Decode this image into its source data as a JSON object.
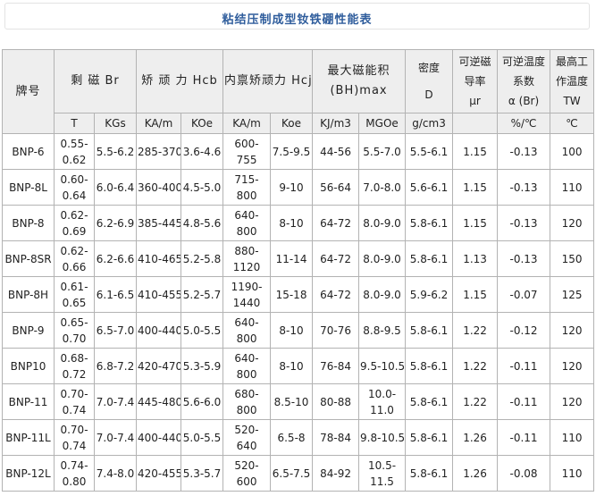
{
  "title": "粘结压制成型钕铁硼性能表",
  "table": {
    "header_row1": [
      {
        "key": "brand",
        "label": "牌号"
      },
      {
        "key": "br",
        "label": "剩 磁   Br"
      },
      {
        "key": "hcb",
        "label": "矫 顽 力   Hcb"
      },
      {
        "key": "hcj",
        "label": "内禀矫顽力 Hcj"
      },
      {
        "key": "bhmax",
        "label": "最大磁能积(BH)max"
      },
      {
        "key": "density",
        "label": "密度"
      },
      {
        "key": "mu",
        "label": "可逆磁导率"
      },
      {
        "key": "alpha",
        "label": "可逆温度系数"
      },
      {
        "key": "tw",
        "label": "最高工作温度"
      }
    ],
    "header_d": "D",
    "header_mu": "μr",
    "header_alpha": "α (Br)",
    "header_tw": "TW",
    "units": [
      "T",
      "KGs",
      "KA/m",
      "KOe",
      "KA/m",
      "Koe",
      "KJ/m3",
      "MGOe",
      "g/cm3",
      "",
      "%/℃",
      "℃"
    ],
    "rows": [
      [
        "BNP-6",
        "0.55-0.62",
        "5.5-6.2",
        "285-370",
        "3.6-4.6",
        "600-755",
        "7.5-9.5",
        "44-56",
        "5.5-7.0",
        "5.5-6.1",
        "1.15",
        "-0.13",
        "100"
      ],
      [
        "BNP-8L",
        "0.60-0.64",
        "6.0-6.4",
        "360-400",
        "4.5-5.0",
        "715-800",
        "9-10",
        "56-64",
        "7.0-8.0",
        "5.6-6.1",
        "1.15",
        "-0.13",
        "110"
      ],
      [
        "BNP-8",
        "0.62-0.69",
        "6.2-6.9",
        "385-445",
        "4.8-5.6",
        "640-800",
        "8-10",
        "64-72",
        "8.0-9.0",
        "5.8-6.1",
        "1.15",
        "-0.13",
        "120"
      ],
      [
        "BNP-8SR",
        "0.62-0.66",
        "6.2-6.6",
        "410-465",
        "5.2-5.8",
        "880-1120",
        "11-14",
        "64-72",
        "8.0-9.0",
        "5.8-6.1",
        "1.13",
        "-0.13",
        "150"
      ],
      [
        "BNP-8H",
        "0.61-0.65",
        "6.1-6.5",
        "410-455",
        "5.2-5.7",
        "1190-1440",
        "15-18",
        "64-72",
        "8.0-9.0",
        "5.9-6.2",
        "1.15",
        "-0.07",
        "125"
      ],
      [
        "BNP-9",
        "0.65-0.70",
        "6.5-7.0",
        "400-440",
        "5.0-5.5",
        "640-800",
        "8-10",
        "70-76",
        "8.8-9.5",
        "5.8-6.1",
        "1.22",
        "-0.12",
        "120"
      ],
      [
        "BNP10",
        "0.68-0.72",
        "6.8-7.2",
        "420-470",
        "5.3-5.9",
        "640-800",
        "8-10",
        "76-84",
        "9.5-10.5",
        "5.8-6.1",
        "1.22",
        "-0.11",
        "120"
      ],
      [
        "BNP-11",
        "0.70-0.74",
        "7.0-7.4",
        "445-480",
        "5.6-6.0",
        "680-800",
        "8.5-10",
        "80-88",
        "10.0-11.0",
        "5.8-6.1",
        "1.22",
        "-0.11",
        "120"
      ],
      [
        "BNP-11L",
        "0.70-0.74",
        "7.0-7.4",
        "400-440",
        "5.0-5.5",
        "520-640",
        "6.5-8",
        "78-84",
        "9.8-10.5",
        "5.8-6.1",
        "1.26",
        "-0.11",
        "110"
      ],
      [
        "BNP-12L",
        "0.74-0.80",
        "7.4-8.0",
        "420-455",
        "5.3-5.7",
        "520-600",
        "6.5-7.5",
        "84-92",
        "10.5-11.5",
        "5.8-6.1",
        "1.26",
        "-0.08",
        "110"
      ]
    ]
  },
  "colors": {
    "title": "#2f5d9c",
    "header_bg": "#eeeeee",
    "border": "#b3b3b3"
  }
}
